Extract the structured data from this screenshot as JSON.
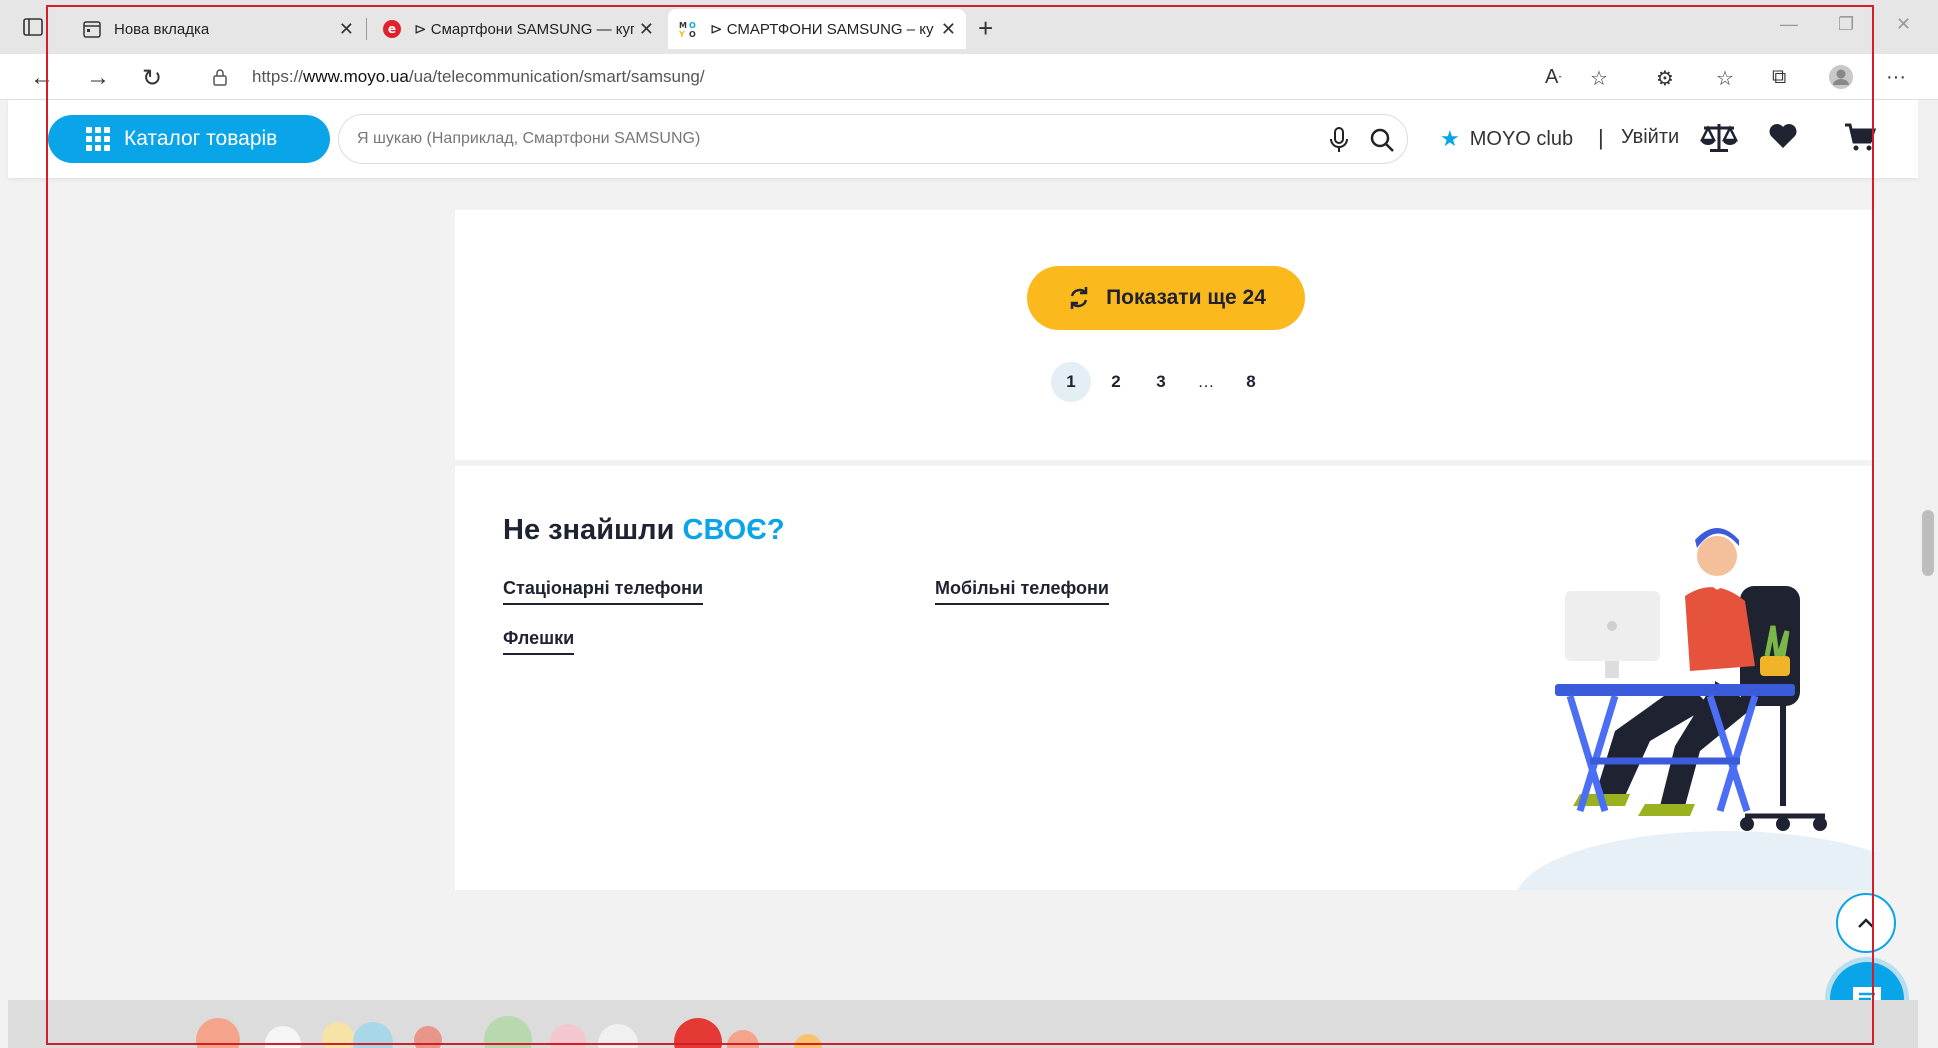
{
  "browser": {
    "tabs": [
      {
        "title": "Нова вкладка",
        "icon": "calendar-icon"
      },
      {
        "title": "⊳ Смартфони SAMSUNG — куп",
        "icon": "eldorado-logo-icon"
      },
      {
        "title": "⊳ СМАРТФОНИ SAMSUNG – ку",
        "icon": "moyo-logo-icon"
      }
    ],
    "url_prefix": "https://",
    "url_host": "www.moyo.ua",
    "url_path": "/ua/telecommunication/smart/samsung/"
  },
  "header": {
    "catalog_label": "Каталог товарів",
    "search_placeholder": "Я шукаю (Наприклад, Смартфони SAMSUNG)",
    "club_label": "MOYO club",
    "separator": "|",
    "login_label": "Увійти"
  },
  "listing": {
    "show_more_label": "Показати ще 24",
    "pages": [
      "1",
      "2",
      "3",
      "…",
      "8"
    ],
    "current_page": "1"
  },
  "not_found": {
    "title_prefix": "Не знайшли ",
    "title_accent": "СВОЄ?",
    "links": [
      "Стаціонарні телефони",
      "Мобільні телефони",
      "Флешки"
    ]
  },
  "colors": {
    "accent": "#0aa5e8",
    "button_yellow": "#fbb91e",
    "text_dark": "#1f2230",
    "frame_red": "#d21e2a"
  }
}
